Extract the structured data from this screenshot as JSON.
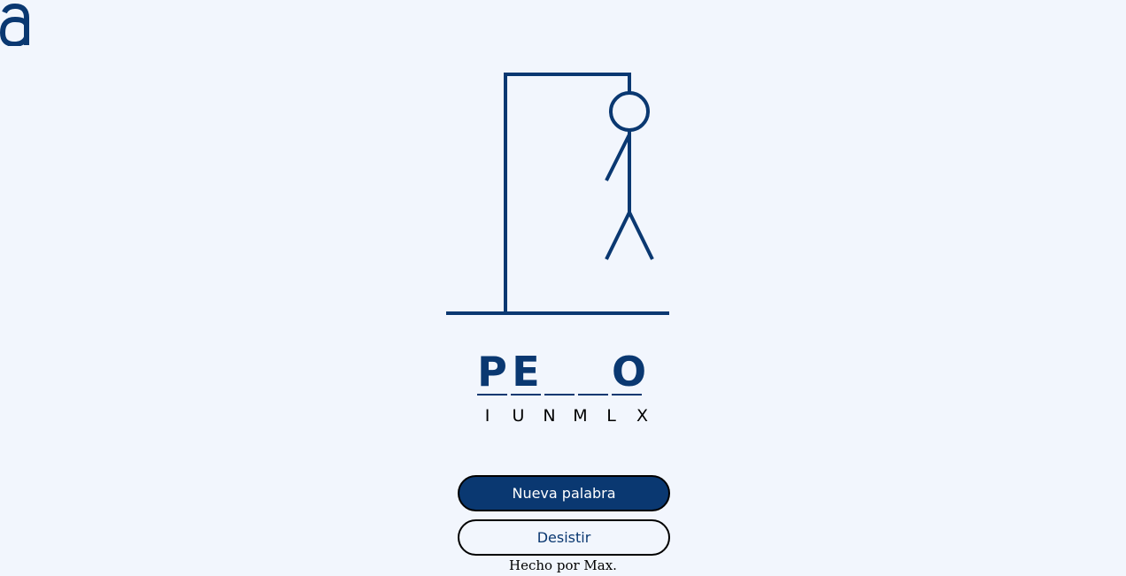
{
  "app": {
    "logo_icon": "alura-logo-icon",
    "accent_color": "#0a3871",
    "background_color": "#f2f6fd"
  },
  "game": {
    "word_slots": [
      "P",
      "E",
      "",
      "",
      "O"
    ],
    "wrong_letters": [
      "I",
      "U",
      "N",
      "M",
      "L",
      "X"
    ],
    "hangman_parts_shown": [
      "gallows",
      "head",
      "body",
      "left-arm",
      "left-leg",
      "right-leg"
    ]
  },
  "buttons": {
    "new_word_label": "Nueva palabra",
    "give_up_label": "Desistir"
  },
  "footer": {
    "credit": "Hecho por Max."
  }
}
